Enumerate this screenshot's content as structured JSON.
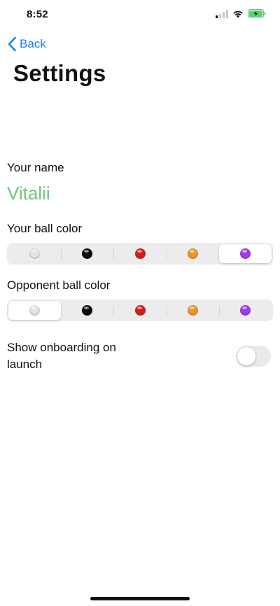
{
  "status_bar": {
    "time": "8:52",
    "icons": [
      "signal-icon",
      "wifi-icon",
      "battery-charging-icon"
    ],
    "battery_color": "#4cd964"
  },
  "nav": {
    "back_label": "Back",
    "back_icon": "chevron-left-icon",
    "title": "Settings",
    "accent_color": "#1a7ef0"
  },
  "name": {
    "label": "Your name",
    "value": "Vitalii",
    "value_color": "#6cc777"
  },
  "ball_color": {
    "label": "Your ball color",
    "selected_index": 4,
    "options": [
      {
        "name": "white",
        "color": "#e3e3e3"
      },
      {
        "name": "black",
        "color": "#0a0a0a"
      },
      {
        "name": "red",
        "color": "#d0211c"
      },
      {
        "name": "orange",
        "color": "#e8962a"
      },
      {
        "name": "purple",
        "color": "#a23ae8"
      }
    ]
  },
  "opponent_ball_color": {
    "label": "Opponent ball color",
    "selected_index": 0,
    "options": [
      {
        "name": "white",
        "color": "#e3e3e3"
      },
      {
        "name": "black",
        "color": "#0a0a0a"
      },
      {
        "name": "red",
        "color": "#d0211c"
      },
      {
        "name": "orange",
        "color": "#e8962a"
      },
      {
        "name": "purple",
        "color": "#a23ae8"
      }
    ]
  },
  "onboarding": {
    "label": "Show onboarding on launch",
    "enabled": false
  }
}
